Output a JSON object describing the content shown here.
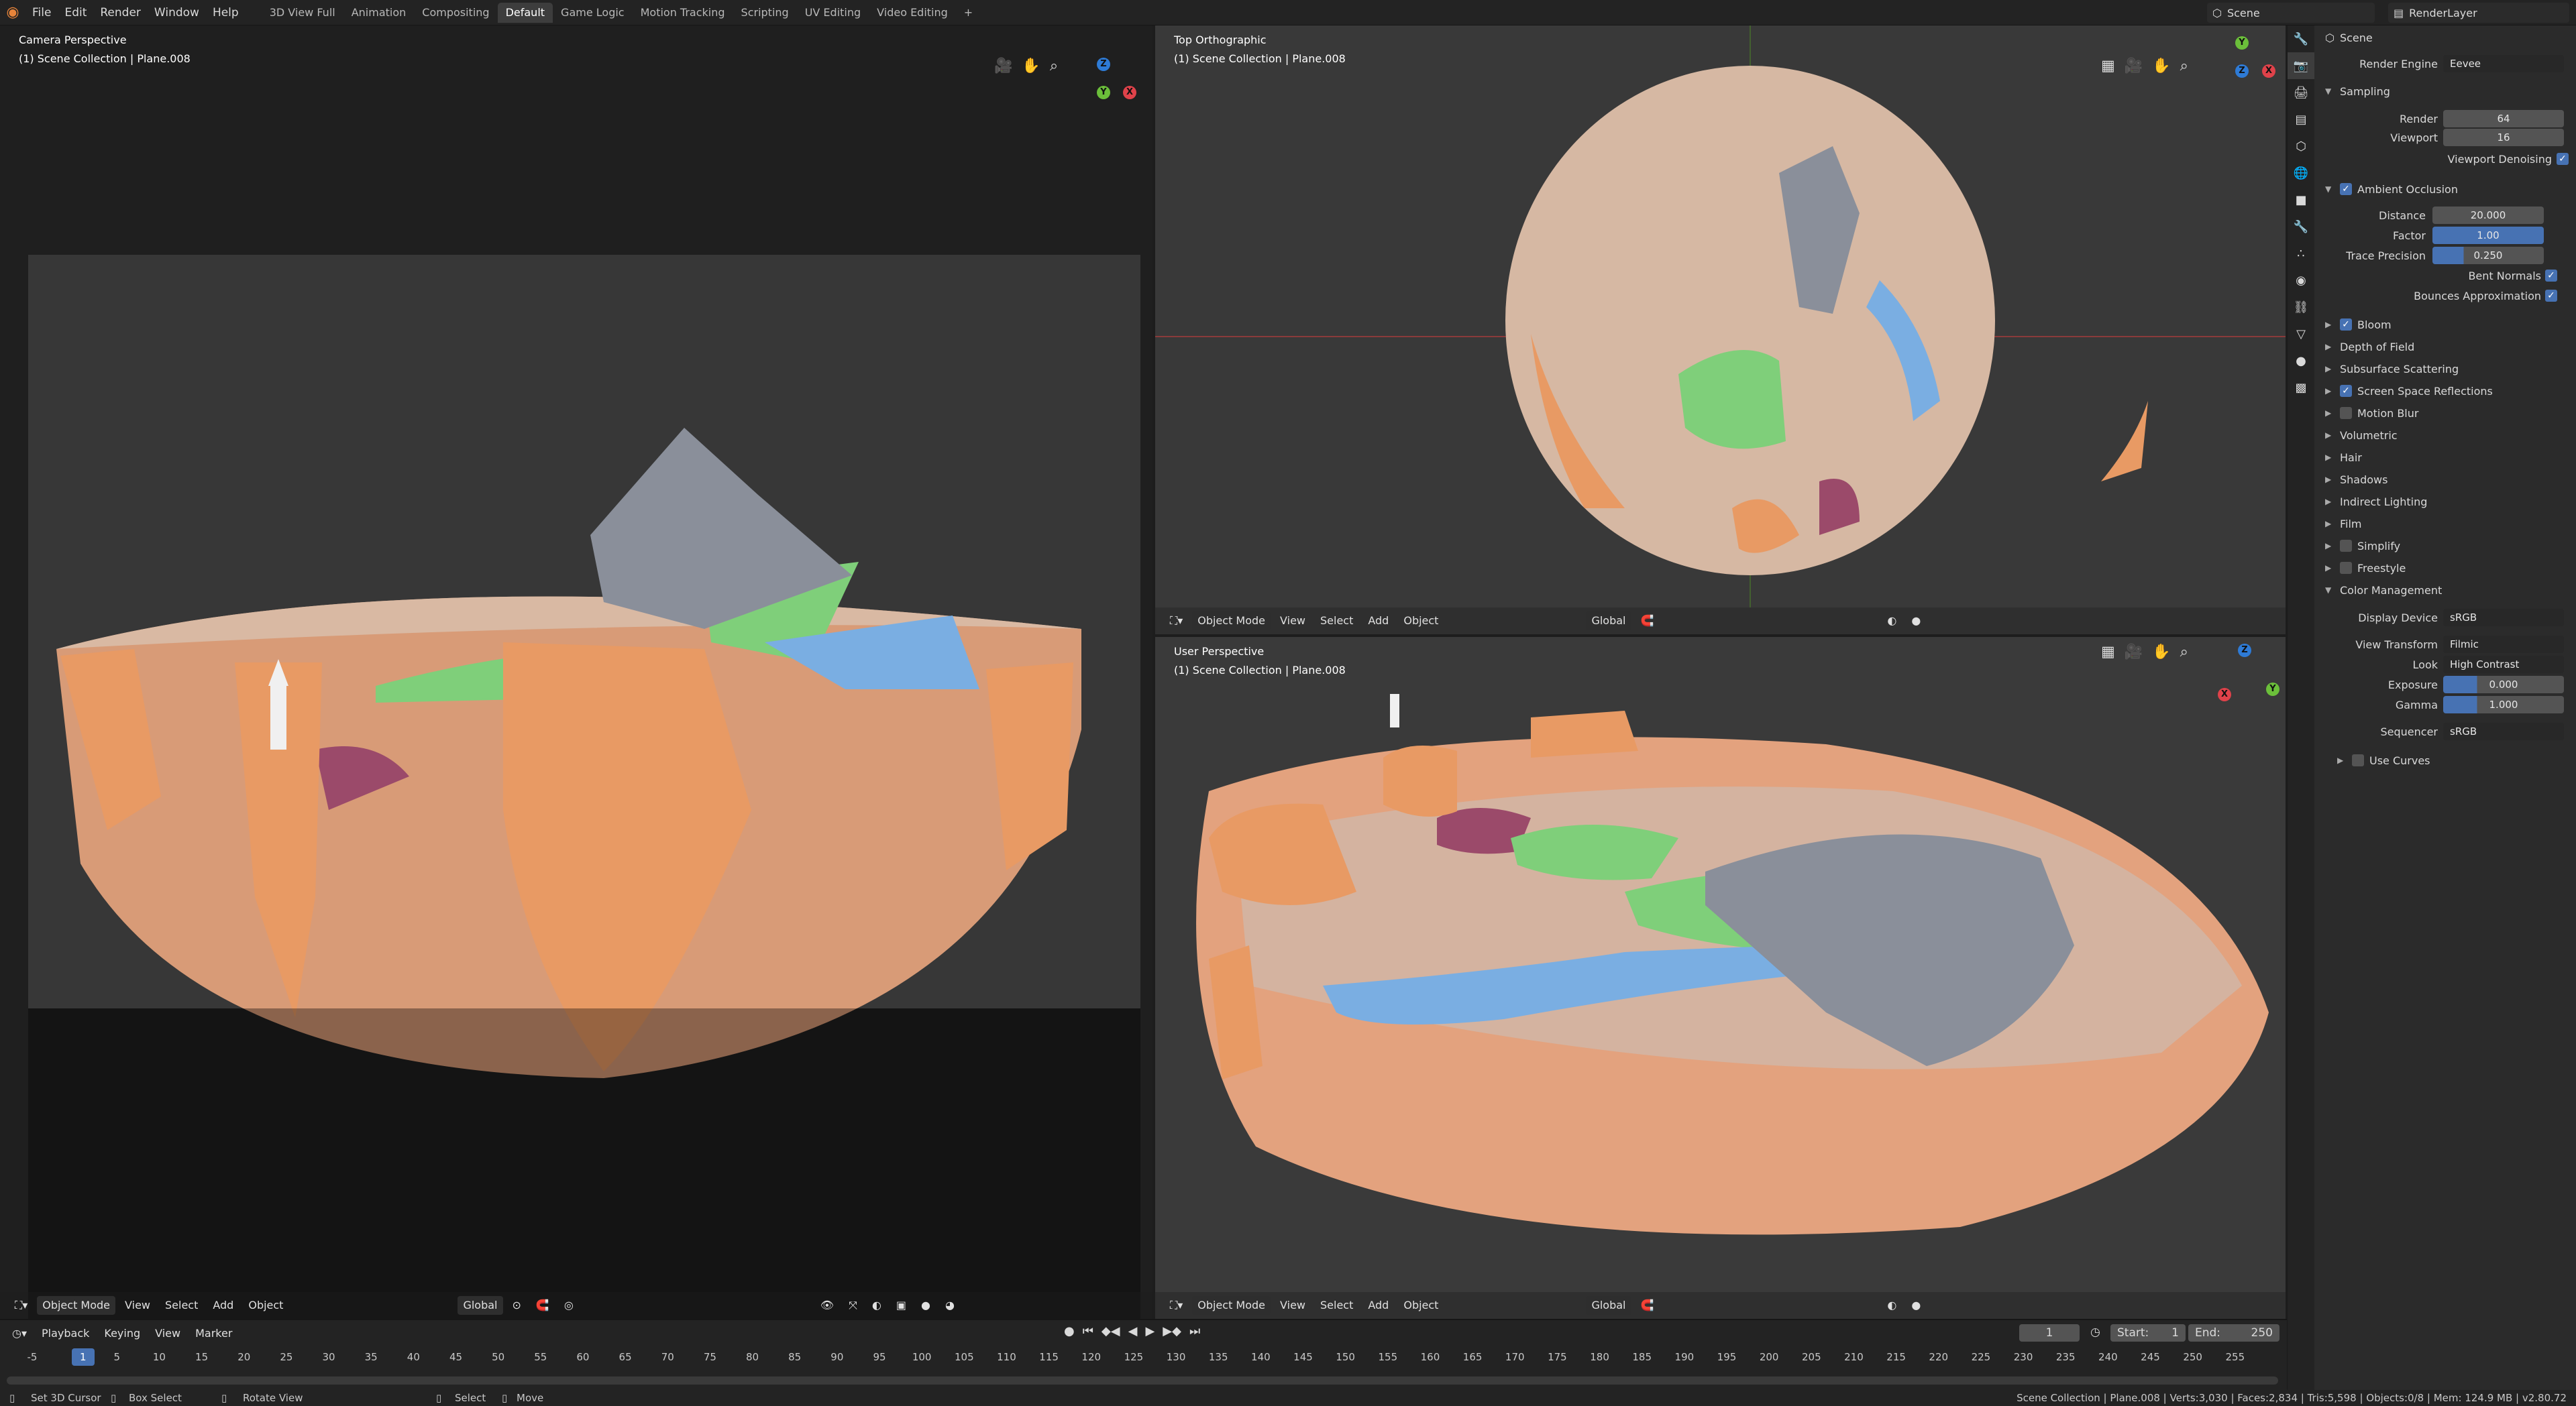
{
  "menu": [
    "File",
    "Edit",
    "Render",
    "Window",
    "Help"
  ],
  "workspaces": [
    "3D View Full",
    "Animation",
    "Compositing",
    "Default",
    "Game Logic",
    "Motion Tracking",
    "Scripting",
    "UV Editing",
    "Video Editing"
  ],
  "active_workspace": "Default",
  "scene": "Scene",
  "render_layer": "RenderLayer",
  "viewports": {
    "camera": {
      "title": "Camera Perspective",
      "collection": "(1) Scene Collection | Plane.008"
    },
    "top": {
      "title": "Top Orthographic",
      "collection": "(1) Scene Collection | Plane.008"
    },
    "user": {
      "title": "User Perspective",
      "collection": "(1) Scene Collection | Plane.008"
    }
  },
  "vp_header": {
    "mode": "Object Mode",
    "view": "View",
    "select": "Select",
    "add": "Add",
    "object": "Object",
    "orientation": "Global"
  },
  "props": {
    "breadcrumb": "Scene",
    "render_engine_label": "Render Engine",
    "render_engine": "Eevee",
    "sampling": "Sampling",
    "render_label": "Render",
    "render": "64",
    "viewport_label": "Viewport",
    "viewport": "16",
    "viewport_denoising": "Viewport Denoising",
    "ao": "Ambient Occlusion",
    "distance_label": "Distance",
    "distance": "20.000",
    "factor_label": "Factor",
    "factor": "1.00",
    "trace_label": "Trace Precision",
    "trace": "0.250",
    "bent": "Bent Normals",
    "bounces": "Bounces Approximation",
    "bloom": "Bloom",
    "dof": "Depth of Field",
    "sss": "Subsurface Scattering",
    "ssr": "Screen Space Reflections",
    "motion_blur": "Motion Blur",
    "volumetric": "Volumetric",
    "hair": "Hair",
    "shadows": "Shadows",
    "indirect": "Indirect Lighting",
    "film": "Film",
    "simplify": "Simplify",
    "freestyle": "Freestyle",
    "color_mgmt": "Color Management",
    "display_device_label": "Display Device",
    "display_device": "sRGB",
    "view_transform_label": "View Transform",
    "view_transform": "Filmic",
    "look_label": "Look",
    "look": "High Contrast",
    "exposure_label": "Exposure",
    "exposure": "0.000",
    "gamma_label": "Gamma",
    "gamma": "1.000",
    "sequencer_label": "Sequencer",
    "sequencer": "sRGB",
    "use_curves": "Use Curves"
  },
  "timeline": {
    "menus": [
      "Playback",
      "Keying",
      "View",
      "Marker"
    ],
    "current_frame": "1",
    "start_label": "Start:",
    "start": "1",
    "end_label": "End:",
    "end": "250",
    "ticks": [
      "-5",
      "0",
      "5",
      "10",
      "15",
      "20",
      "25",
      "30",
      "35",
      "40",
      "45",
      "50",
      "55",
      "60",
      "65",
      "70",
      "75",
      "80",
      "85",
      "90",
      "95",
      "100",
      "105",
      "110",
      "115",
      "120",
      "125",
      "130",
      "135",
      "140",
      "145",
      "150",
      "155",
      "160",
      "165",
      "170",
      "175",
      "180",
      "185",
      "190",
      "195",
      "200",
      "205",
      "210",
      "215",
      "220",
      "225",
      "230",
      "235",
      "240",
      "245",
      "250",
      "255"
    ],
    "playhead": "1"
  },
  "status": {
    "set_cursor": "Set 3D Cursor",
    "box_select": "Box Select",
    "rotate": "Rotate View",
    "select": "Select",
    "move": "Move",
    "stats": "Scene Collection | Plane.008 | Verts:3,030 | Faces:2,834 | Tris:5,598 | Objects:0/8 | Mem: 124.9 MB | v2.80.72"
  },
  "colors": {
    "accent": "#4772b3",
    "terrain": "#e7a57c",
    "grass": "#7fcf7a",
    "water": "#7aaee2",
    "rock": "#8a8f9a",
    "flower": "#9b4a6a"
  }
}
